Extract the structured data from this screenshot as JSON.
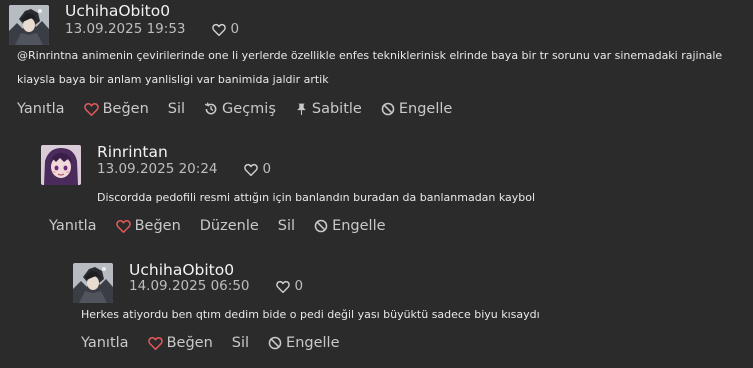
{
  "colors": {
    "background": "#2b2b2b",
    "heart": "#e05a5a",
    "text": "#e3e3e3",
    "muted": "#bdbdbd"
  },
  "actions": {
    "reply": "Yanıtla",
    "like": "Beğen",
    "delete": "Sil",
    "history": "Geçmiş",
    "pin": "Sabitle",
    "block": "Engelle",
    "edit": "Düzenle"
  },
  "comments": [
    {
      "username": "UchihaObito0",
      "date": "13.09.2025 19:53",
      "likes": "0",
      "avatar_icon": "anime-character-avatar",
      "lines": [
        "@Rinrintna animenin çevirilerinde one li yerlerde özellikle enfes tekniklerinisk elrinde baya bir tr sorunu var sinemadaki rajinale",
        "kiaysla baya bir anlam yanlisligi var banimida jaldir artik"
      ]
    },
    {
      "username": "Rinrintan",
      "date": "13.09.2025 20:24",
      "likes": "0",
      "avatar_icon": "purple-hair-anime-avatar",
      "lines": [
        "Discordda pedofili resmi attığın için banlandın buradan da banlanmadan kaybol"
      ]
    },
    {
      "username": "UchihaObito0",
      "date": "14.09.2025 06:50",
      "likes": "0",
      "avatar_icon": "anime-character-avatar",
      "lines": [
        "Herkes atiyordu ben qtım dedim bide o pedi değil yası büyüktü sadece biyu kısaydı"
      ]
    }
  ]
}
